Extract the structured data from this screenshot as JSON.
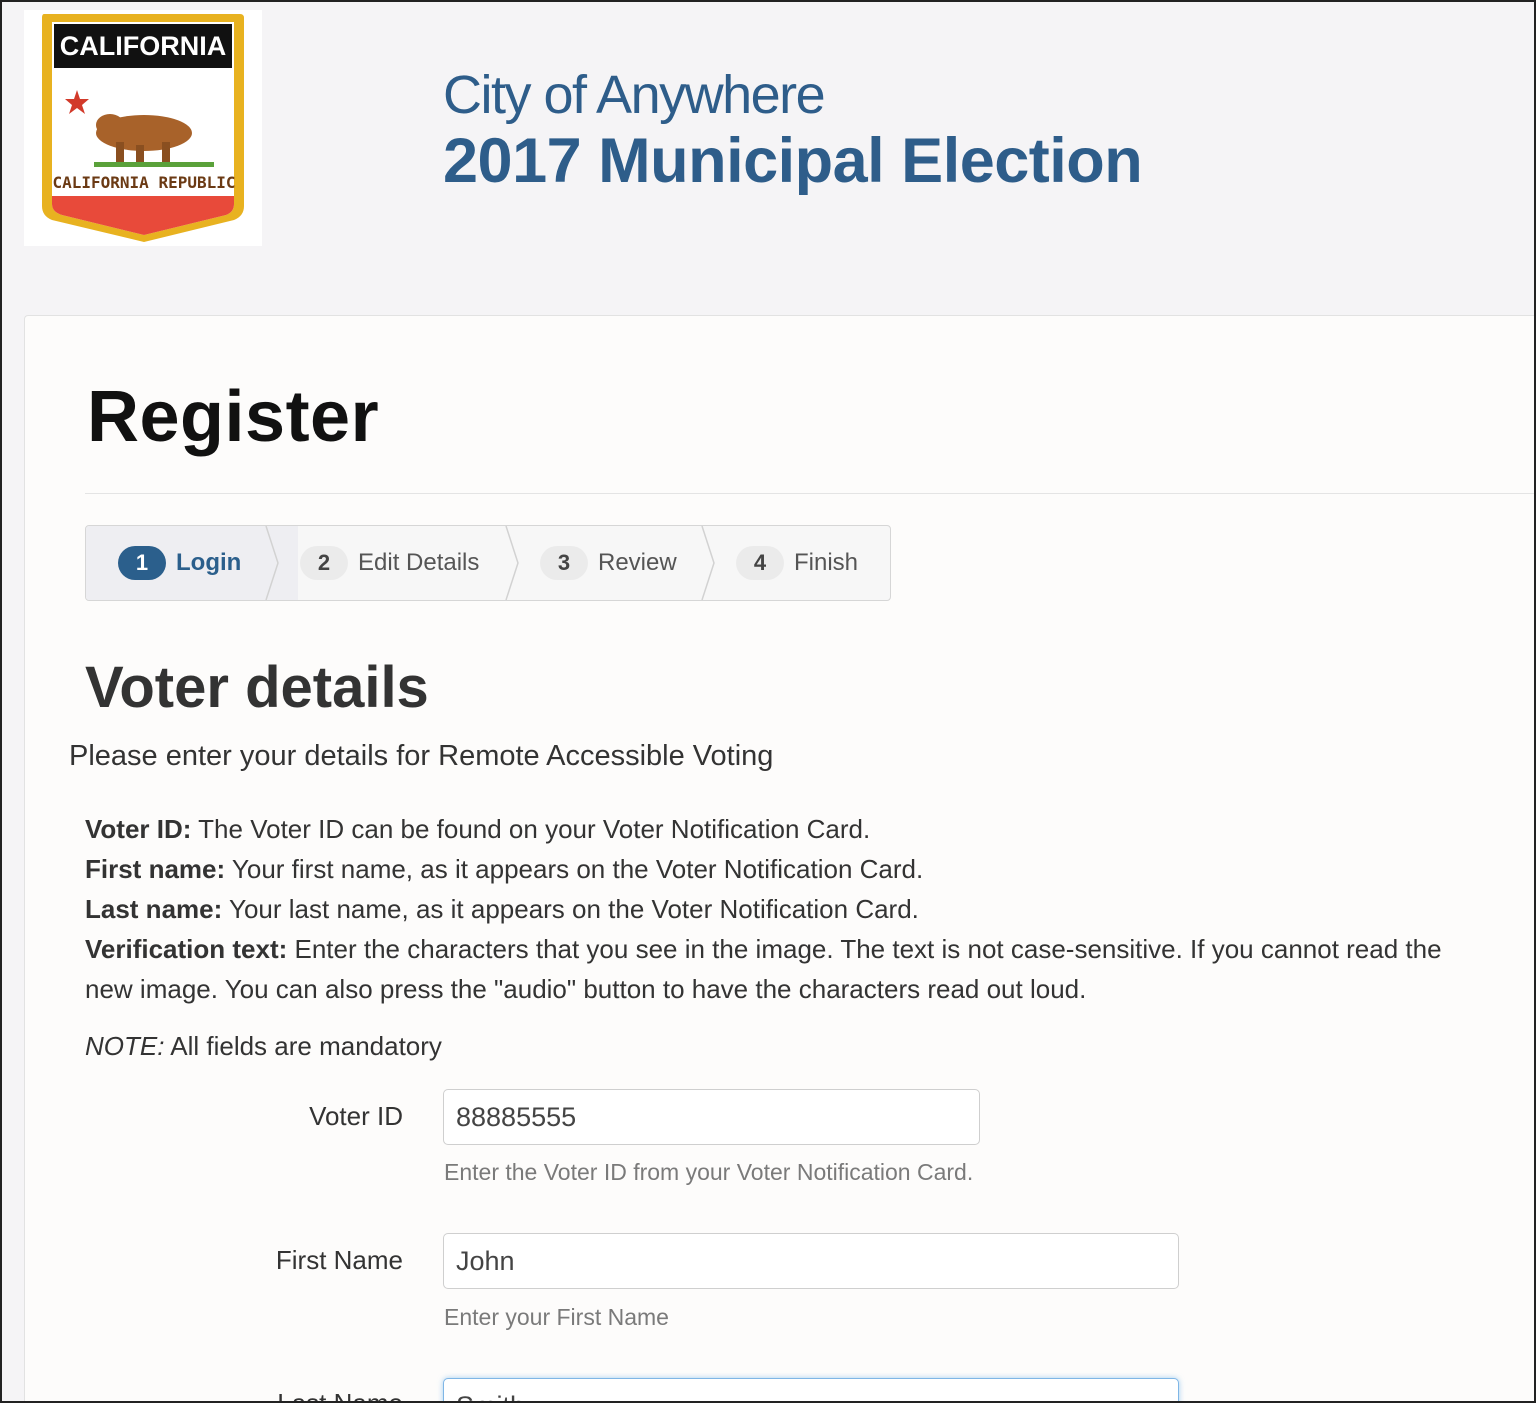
{
  "header": {
    "logo": {
      "top_text": "CALIFORNIA",
      "bottom_text": "CALIFORNIA REPUBLIC",
      "alt": "California state flag shield"
    },
    "city": "City of Anywhere",
    "election": "2017 Municipal Election"
  },
  "page": {
    "title": "Register"
  },
  "wizard": {
    "steps": [
      {
        "num": "1",
        "label": "Login",
        "active": true
      },
      {
        "num": "2",
        "label": "Edit Details",
        "active": false
      },
      {
        "num": "3",
        "label": "Review",
        "active": false
      },
      {
        "num": "4",
        "label": "Finish",
        "active": false
      }
    ]
  },
  "section": {
    "title": "Voter details",
    "intro": "Please enter your details for Remote Accessible Voting"
  },
  "help": [
    {
      "term": "Voter ID:",
      "text": " The Voter ID can be found on your Voter Notification Card."
    },
    {
      "term": "First name:",
      "text": " Your first name, as it appears on the Voter Notification Card."
    },
    {
      "term": "Last name:",
      "text": " Your last name, as it appears on the Voter Notification Card."
    },
    {
      "term": "Verification text:",
      "text": " Enter the characters that you see in the image. The text is not case-sensitive. If you cannot read the"
    },
    {
      "term": "",
      "text": "new image. You can also press the \"audio\" button to have the characters read out loud."
    }
  ],
  "note": {
    "label": "NOTE:",
    "text": " All fields are mandatory"
  },
  "form": {
    "voter_id": {
      "label": "Voter ID",
      "value": "88885555",
      "help": "Enter the Voter ID from your Voter Notification Card."
    },
    "first_name": {
      "label": "First Name",
      "value": "John",
      "help": "Enter your First Name"
    },
    "last_name": {
      "label": "Last Name",
      "value": "Smith"
    }
  },
  "colors": {
    "brand": "#2e5d8a",
    "active_step": "#2b5f8c",
    "focus": "#7fb6e6"
  }
}
